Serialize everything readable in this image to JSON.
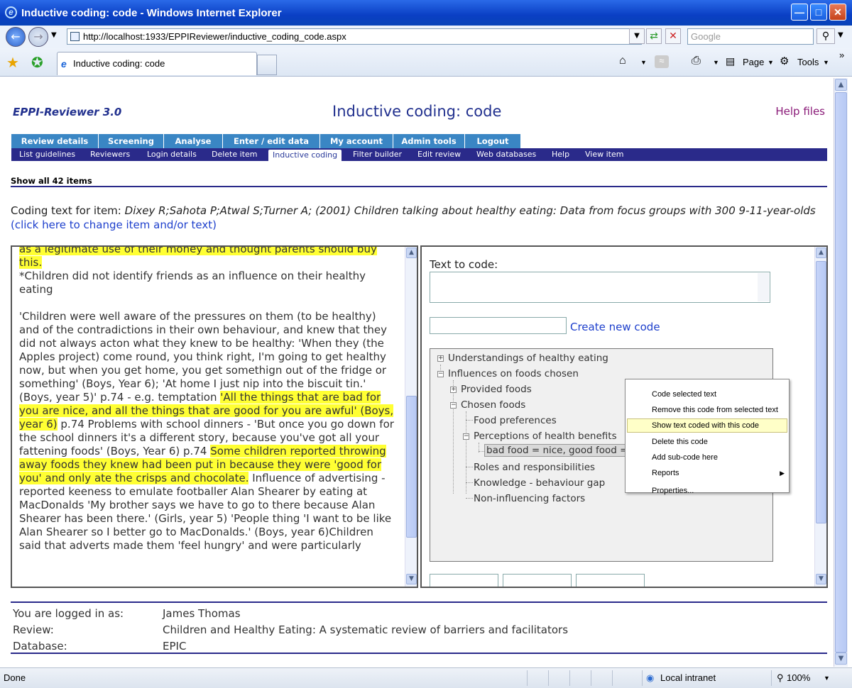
{
  "window": {
    "title": "Inductive coding: code - Windows Internet Explorer"
  },
  "browser": {
    "url": "http://localhost:1933/EPPIReviewer/inductive_coding_code.aspx",
    "search_placeholder": "Google",
    "tab_title": "Inductive coding: code",
    "page_menu": "Page",
    "tools_menu": "Tools"
  },
  "page": {
    "brand": "EPPI-Reviewer 3.0",
    "title": "Inductive coding: code",
    "help": "Help files",
    "main_tabs": [
      "Review details",
      "Screening",
      "Analyse",
      "Enter / edit data",
      "My account",
      "Admin tools",
      "Logout"
    ],
    "sub_tabs": [
      "List guidelines",
      "Reviewers",
      "Login details",
      "Delete item",
      "Inductive coding",
      "Filter builder",
      "Edit review",
      "Web databases",
      "Help",
      "View item"
    ],
    "active_sub_tab": "Inductive coding",
    "show_all": "Show all 42 items",
    "coding_label": "Coding text for item:",
    "coding_item": "Dixey R;Sahota P;Atwal S;Turner A; (2001) Children talking about healthy eating: Data from focus groups with 300 9-11-year-olds",
    "change_link": "(click here to change item and/or text)"
  },
  "left_text": {
    "l1_hl": "as a legitimate use of their money and thought parents should buy this.",
    "l2": "*Children did not identify friends as an influence on their healthy eating",
    "p2_a": "'Children were well aware of the pressures on them (to be healthy) and of the contradictions in their own behaviour, and knew that they did not always acton what they knew to be healthy: 'When they (the Apples project) come round, you think right, I'm going to get healthy now, but when you get home, you get somethign out of the fridge or something' (Boys, Year 6); 'At home I just nip into the biscuit tin.' (Boys, year 5)' p.74 - e.g. temptation ",
    "p2_hl1": "'All the things that are bad for you are nice, and all the things that are good for you are awful' (Boys, year 6)",
    "p2_b": " p.74 Problems with school dinners - 'But once you go down for the school dinners it's a different story, because you've got all your fattening foods' (Boys, Year 6) p.74 ",
    "p2_hl2": "Some children reported throwing away foods they knew had been put in because they were 'good for you' and only ate the crisps and chocolate.",
    "p2_c": " Influence of advertising - reported keeness to emulate footballer Alan Shearer by eating at MacDonalds 'My brother says we have to go to there because Alan Shearer has been there.' (Girls, year 5) 'People thing 'I want to be like Alan Shearer so I better go to MacDonalds.' (Boys, year 6)Children said that adverts made them 'feel hungry' and were particularly"
  },
  "right_panel": {
    "text_to_code": "Text to code:",
    "create_new_code": "Create new code",
    "tree": [
      "Understandings of healthy eating",
      "Influences on foods chosen",
      "Provided foods",
      "Chosen foods",
      "Food preferences",
      "Perceptions of health benefits",
      "bad food = nice, good food = awful",
      "Roles and responsibilities",
      "Knowledge - behaviour gap",
      "Non-influencing factors"
    ]
  },
  "context_menu": [
    "Code selected text",
    "Remove this code from selected text",
    "Show text coded with this code",
    "Delete this code",
    "Add sub-code here",
    "Reports",
    "Properties..."
  ],
  "login": {
    "logged_in_label": "You are logged in as:",
    "logged_in_value": "James Thomas",
    "review_label": "Review:",
    "review_value": "Children and Healthy Eating: A systematic review of barriers and facilitators",
    "database_label": "Database:",
    "database_value": "EPIC"
  },
  "statusbar": {
    "status": "Done",
    "zone": "Local intranet",
    "zoom": "100%"
  },
  "colors": {
    "title_blue": "#21308e",
    "nav_dark": "#2a2a8a",
    "tab_blue": "#3a86c4",
    "highlight": "#ffff33",
    "help_purple": "#8a1a78"
  }
}
